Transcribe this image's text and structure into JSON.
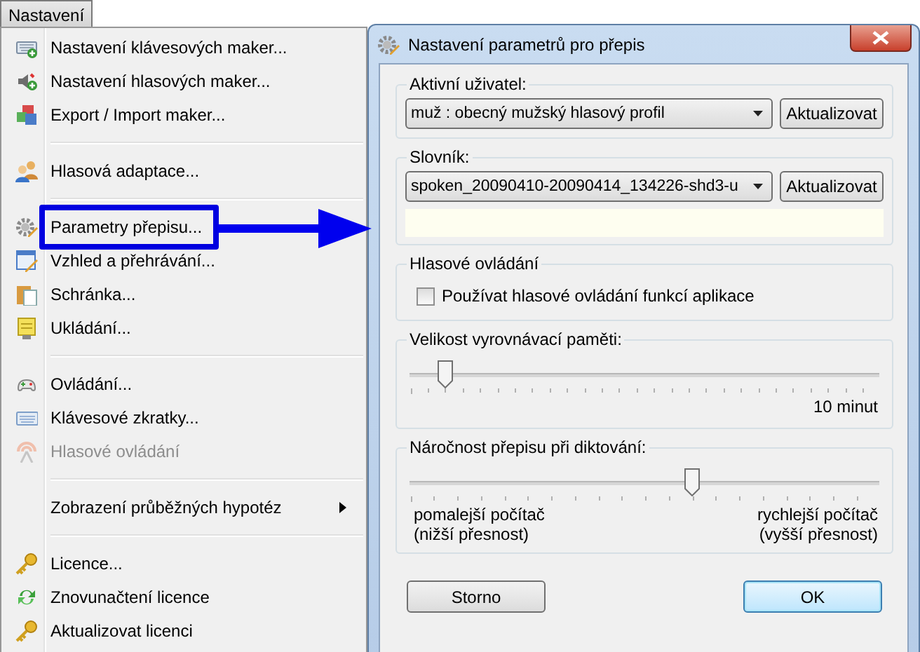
{
  "menu_button": {
    "label": "Nastavení"
  },
  "menu": {
    "items": [
      {
        "kind": "item",
        "label": "Nastavení klávesových maker...",
        "disabled": false,
        "highlighted": false
      },
      {
        "kind": "item",
        "label": "Nastavení hlasových maker...",
        "disabled": false,
        "highlighted": false
      },
      {
        "kind": "item",
        "label": "Export / Import maker...",
        "disabled": false,
        "highlighted": false
      },
      {
        "kind": "separator"
      },
      {
        "kind": "item",
        "label": "Hlasová adaptace...",
        "disabled": false,
        "highlighted": false
      },
      {
        "kind": "separator"
      },
      {
        "kind": "item",
        "label": "Parametry přepisu...",
        "disabled": false,
        "highlighted": true
      },
      {
        "kind": "item",
        "label": "Vzhled a přehrávání...",
        "disabled": false,
        "highlighted": false
      },
      {
        "kind": "item",
        "label": "Schránka...",
        "disabled": false,
        "highlighted": false
      },
      {
        "kind": "item",
        "label": "Ukládání...",
        "disabled": false,
        "highlighted": false
      },
      {
        "kind": "separator"
      },
      {
        "kind": "item",
        "label": "Ovládání...",
        "disabled": false,
        "highlighted": false
      },
      {
        "kind": "item",
        "label": "Klávesové zkratky...",
        "disabled": false,
        "highlighted": false
      },
      {
        "kind": "item",
        "label": "Hlasové ovládání",
        "disabled": true,
        "highlighted": false
      },
      {
        "kind": "separator"
      },
      {
        "kind": "submenu",
        "label": "Zobrazení průběžných hypotéz",
        "disabled": false,
        "highlighted": false
      },
      {
        "kind": "separator"
      },
      {
        "kind": "item",
        "label": "Licence...",
        "disabled": false,
        "highlighted": false
      },
      {
        "kind": "item",
        "label": "Znovunačtení licence",
        "disabled": false,
        "highlighted": false
      },
      {
        "kind": "item",
        "label": "Aktualizovat licenci",
        "disabled": false,
        "highlighted": false
      }
    ]
  },
  "dialog": {
    "title": "Nastavení parametrů pro přepis",
    "groups": [
      {
        "kind": "combo",
        "label": "Aktivní uživatel:",
        "value": "muž : obecný mužský hlasový profil",
        "button": "Aktualizovat",
        "note_area": false
      },
      {
        "kind": "combo",
        "label": "Slovník:",
        "value": "spoken_20090410-20090414_134226-shd3-u",
        "button": "Aktualizovat",
        "note_area": true
      },
      {
        "kind": "checkbox",
        "label": "Hlasové ovládání",
        "option": "Používat hlasové ovládání funkcí aplikace",
        "checked": false
      },
      {
        "kind": "slider",
        "label": "Velikost vyrovnávací paměti:",
        "level": 0.075,
        "reading": "10 minut"
      },
      {
        "kind": "slider",
        "label": "Náročnost přepisu při diktování:",
        "level": 0.6,
        "min_label": "pomalejší počítač\n(nižší přesnost)",
        "max_label": "rychlejší počítač\n(vyšší přesnost)"
      }
    ],
    "buttons": [
      {
        "label": "Storno",
        "default": false
      },
      {
        "label": "OK",
        "default": true
      }
    ]
  }
}
